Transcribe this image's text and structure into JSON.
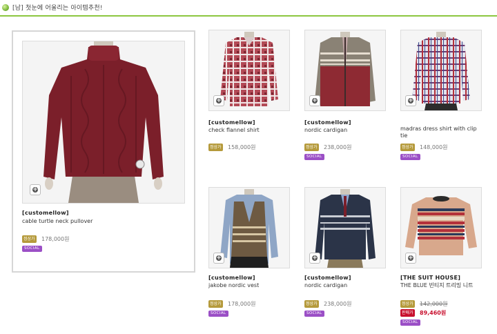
{
  "header": {
    "title": "[남] 첫눈에 어울리는 아이템추천!"
  },
  "featured": {
    "brand": "[customellow]",
    "name": "cable turtle neck pullover",
    "price_tag": "정상가",
    "price": "178,000원",
    "badge": "SOCIAL"
  },
  "products": [
    {
      "brand": "[customellow]",
      "name": "check flannel shirt",
      "price_tag": "정상가",
      "price": "158,000원",
      "badge": ""
    },
    {
      "brand": "[customellow]",
      "name": "nordic cardigan",
      "price_tag": "정상가",
      "price": "238,000원",
      "badge": "SOCIAL"
    },
    {
      "brand": "",
      "name": "madras dress shirt with clip tie",
      "price_tag": "정상가",
      "price": "148,000원",
      "badge": "SOCIAL"
    },
    {
      "brand": "[customellow]",
      "name": "jakobe nordic vest",
      "price_tag": "정상가",
      "price": "178,000원",
      "badge": "SOCIAL"
    },
    {
      "brand": "[customellow]",
      "name": "nordic cardigan",
      "price_tag": "정상가",
      "price": "238,000원",
      "badge": "SOCIAL"
    },
    {
      "brand": "[THE SUIT HOUSE]",
      "name": "THE BLUE 빈티지 트리밍 니트",
      "price_tag": "정상가",
      "price": "142,000원",
      "sale_tag": "판매가",
      "sale_price": "89,460원",
      "badge": "SOCIAL"
    }
  ],
  "colors": {
    "accent_line": "#8cc63f",
    "price_tag": "#b59a3b",
    "sale": "#c8102e",
    "social": "#9b4fc6"
  },
  "icons": {
    "zoom": "plus-circle-icon",
    "header": "green-dot-icon"
  }
}
